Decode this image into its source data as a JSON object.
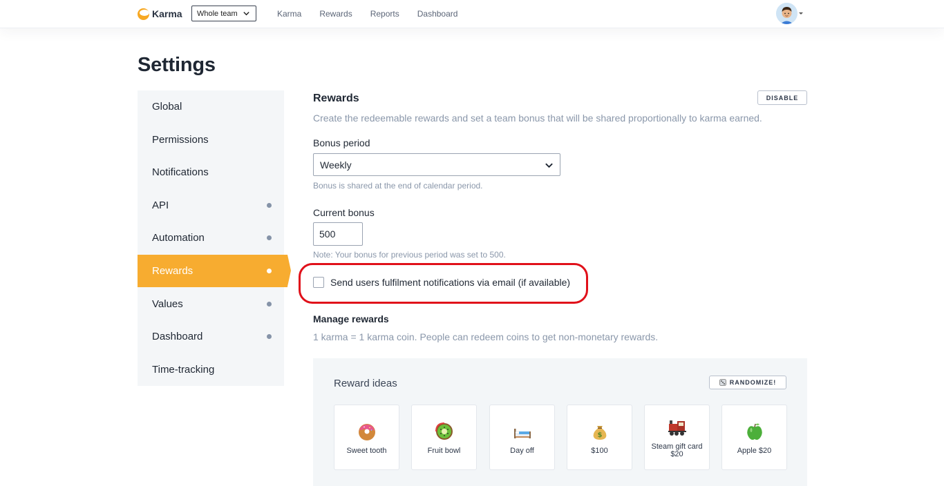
{
  "app": {
    "brand": "Karma",
    "accent": "#f7ac30"
  },
  "topbar": {
    "team_select": "Whole team",
    "nav": [
      "Karma",
      "Rewards",
      "Reports",
      "Dashboard"
    ]
  },
  "page_title": "Settings",
  "sidebar": {
    "items": [
      {
        "label": "Global",
        "dot": false,
        "active": false
      },
      {
        "label": "Permissions",
        "dot": false,
        "active": false
      },
      {
        "label": "Notifications",
        "dot": false,
        "active": false
      },
      {
        "label": "API",
        "dot": true,
        "active": false
      },
      {
        "label": "Automation",
        "dot": true,
        "active": false
      },
      {
        "label": "Rewards",
        "dot": true,
        "active": true
      },
      {
        "label": "Values",
        "dot": true,
        "active": false
      },
      {
        "label": "Dashboard",
        "dot": true,
        "active": false
      },
      {
        "label": "Time-tracking",
        "dot": false,
        "active": false
      }
    ]
  },
  "rewards": {
    "heading": "Rewards",
    "disable_label": "DISABLE",
    "description": "Create the redeemable rewards and set a team bonus that will be shared proportionally to karma earned.",
    "bonus_period": {
      "label": "Bonus period",
      "value": "Weekly",
      "hint": "Bonus is shared at the end of calendar period."
    },
    "current_bonus": {
      "label": "Current bonus",
      "value": "500",
      "note": "Note: Your bonus for previous period was set to 500."
    },
    "email_checkbox": {
      "label": "Send users fulfilment notifications via email (if available)",
      "checked": false
    },
    "manage": {
      "heading": "Manage rewards",
      "description": "1 karma = 1 karma coin. People can redeem coins to get non-monetary rewards."
    },
    "ideas": {
      "title": "Reward ideas",
      "randomize_label": "RANDOMIZE!",
      "items": [
        {
          "label": "Sweet tooth",
          "icon": "donut-icon"
        },
        {
          "label": "Fruit bowl",
          "icon": "kiwi-icon"
        },
        {
          "label": "Day off",
          "icon": "bed-icon"
        },
        {
          "label": "$100",
          "icon": "money-bag-icon"
        },
        {
          "label": "Steam gift card $20",
          "icon": "locomotive-icon"
        },
        {
          "label": "Apple $20",
          "icon": "apple-icon"
        }
      ]
    }
  }
}
